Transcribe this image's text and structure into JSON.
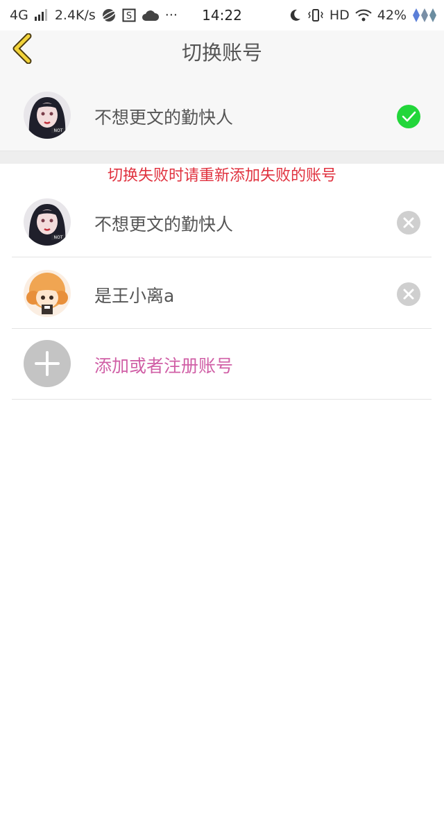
{
  "status_bar": {
    "network": "4G",
    "speed": "2.4K/s",
    "time": "14:22",
    "hd": "HD",
    "battery": "42%",
    "more": "···"
  },
  "header": {
    "title": "切换账号"
  },
  "current_account": {
    "name": "不想更文的勤快人",
    "avatar_icon": "girl-portrait-avatar",
    "check_color": "#22d63a"
  },
  "notice": {
    "text": "切换失败时请重新添加失败的账号",
    "color": "#e0323f"
  },
  "accounts": [
    {
      "name": "不想更文的勤快人",
      "avatar_icon": "girl-portrait-avatar"
    },
    {
      "name": "是王小离a",
      "avatar_icon": "cartoon-girl-avatar"
    }
  ],
  "add_account": {
    "label": "添加或者注册账号",
    "color": "#d05fa6"
  }
}
